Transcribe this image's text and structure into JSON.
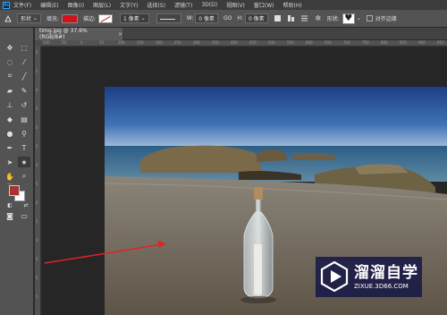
{
  "app": {
    "logo": "Ps"
  },
  "menu": [
    "文件(F)",
    "编辑(E)",
    "图像(I)",
    "图层(L)",
    "文字(Y)",
    "选择(S)",
    "滤镜(T)",
    "3D(D)",
    "视图(V)",
    "窗口(W)",
    "帮助(H)"
  ],
  "options": {
    "mode": "形状",
    "fill_label": "填充:",
    "stroke_label": "描边:",
    "stroke_width": "1 像素",
    "w_label": "W:",
    "w_value": "0 像素",
    "go_label": "GO",
    "h_label": "H:",
    "h_value": "0 像素",
    "shape_label": "形状:",
    "align_edges": "对齐边缘",
    "fill_color": "#d0121b"
  },
  "document": {
    "tab_title": "timg.jpg @ 37.6%(RGB/8#)",
    "tab_close": "×"
  },
  "ruler": {
    "top": [
      "100",
      "50",
      "0",
      "50",
      "100",
      "150",
      "200",
      "250",
      "300",
      "350",
      "400",
      "450",
      "500",
      "550",
      "600",
      "650",
      "700",
      "750",
      "800",
      "850",
      "900",
      "950"
    ],
    "left": [
      "0",
      "5",
      "0",
      "5",
      "0",
      "5",
      "0",
      "5",
      "0",
      "5",
      "0",
      "5",
      "0",
      "5"
    ]
  },
  "watermark": {
    "title": "溜溜自学",
    "subtitle": "ZIXUE.3D66.COM",
    "color": "#121446"
  },
  "annotation": {
    "arrow_color": "#e32222"
  }
}
